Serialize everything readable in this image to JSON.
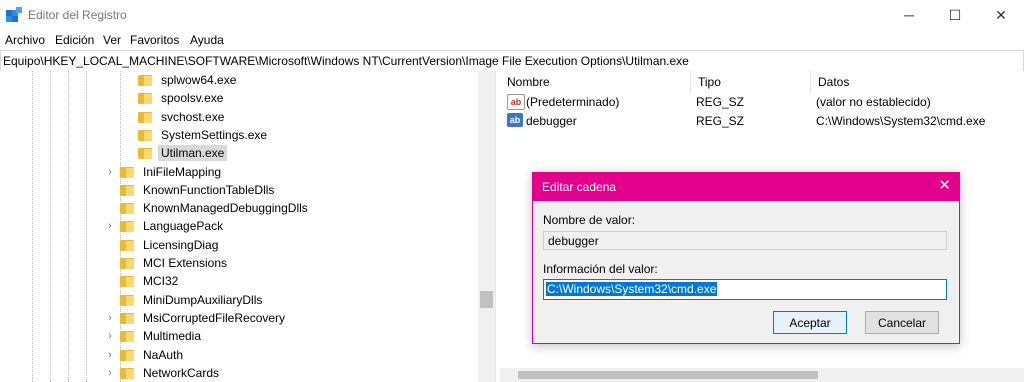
{
  "window": {
    "title": "Editor del Registro",
    "minimize": "─",
    "maximize": "☐",
    "close": "✕"
  },
  "menu": [
    "Archivo",
    "Edición",
    "Ver",
    "Favoritos",
    "Ayuda"
  ],
  "address": "Equipo\\HKEY_LOCAL_MACHINE\\SOFTWARE\\Microsoft\\Windows NT\\CurrentVersion\\Image File Execution Options\\Utilman.exe",
  "tree": {
    "items": [
      {
        "label": "splwow64.exe",
        "expandable": false,
        "selected": false,
        "level": 2
      },
      {
        "label": "spoolsv.exe",
        "expandable": false,
        "selected": false,
        "level": 2
      },
      {
        "label": "svchost.exe",
        "expandable": false,
        "selected": false,
        "level": 2
      },
      {
        "label": "SystemSettings.exe",
        "expandable": false,
        "selected": false,
        "level": 2
      },
      {
        "label": "Utilman.exe",
        "expandable": false,
        "selected": true,
        "level": 2
      },
      {
        "label": "IniFileMapping",
        "expandable": true,
        "selected": false,
        "level": 1
      },
      {
        "label": "KnownFunctionTableDlls",
        "expandable": false,
        "selected": false,
        "level": 1
      },
      {
        "label": "KnownManagedDebuggingDlls",
        "expandable": false,
        "selected": false,
        "level": 1
      },
      {
        "label": "LanguagePack",
        "expandable": true,
        "selected": false,
        "level": 1
      },
      {
        "label": "LicensingDiag",
        "expandable": false,
        "selected": false,
        "level": 1
      },
      {
        "label": "MCI Extensions",
        "expandable": false,
        "selected": false,
        "level": 1
      },
      {
        "label": "MCI32",
        "expandable": false,
        "selected": false,
        "level": 1
      },
      {
        "label": "MiniDumpAuxiliaryDlls",
        "expandable": false,
        "selected": false,
        "level": 1
      },
      {
        "label": "MsiCorruptedFileRecovery",
        "expandable": true,
        "selected": false,
        "level": 1
      },
      {
        "label": "Multimedia",
        "expandable": true,
        "selected": false,
        "level": 1
      },
      {
        "label": "NaAuth",
        "expandable": true,
        "selected": false,
        "level": 1
      },
      {
        "label": "NetworkCards",
        "expandable": true,
        "selected": false,
        "level": 1
      }
    ],
    "chevron": "›"
  },
  "list": {
    "headers": {
      "name": "Nombre",
      "type": "Tipo",
      "data": "Datos"
    },
    "rows": [
      {
        "icon": "ab",
        "name": "(Predeterminado)",
        "type": "REG_SZ",
        "data": "(valor no establecido)"
      },
      {
        "icon": "ab",
        "name": "debugger",
        "type": "REG_SZ",
        "data": "C:\\Windows\\System32\\cmd.exe"
      }
    ]
  },
  "dialog": {
    "title": "Editar cadena",
    "close": "✕",
    "name_label": "Nombre de valor:",
    "name_value": "debugger",
    "data_label": "Información del valor:",
    "data_value": "C:\\Windows\\System32\\cmd.exe",
    "ok": "Aceptar",
    "cancel": "Cancelar"
  },
  "colors": {
    "accent": "#e3008c",
    "selection": "#0078d7",
    "folder": "#ffd96b"
  }
}
